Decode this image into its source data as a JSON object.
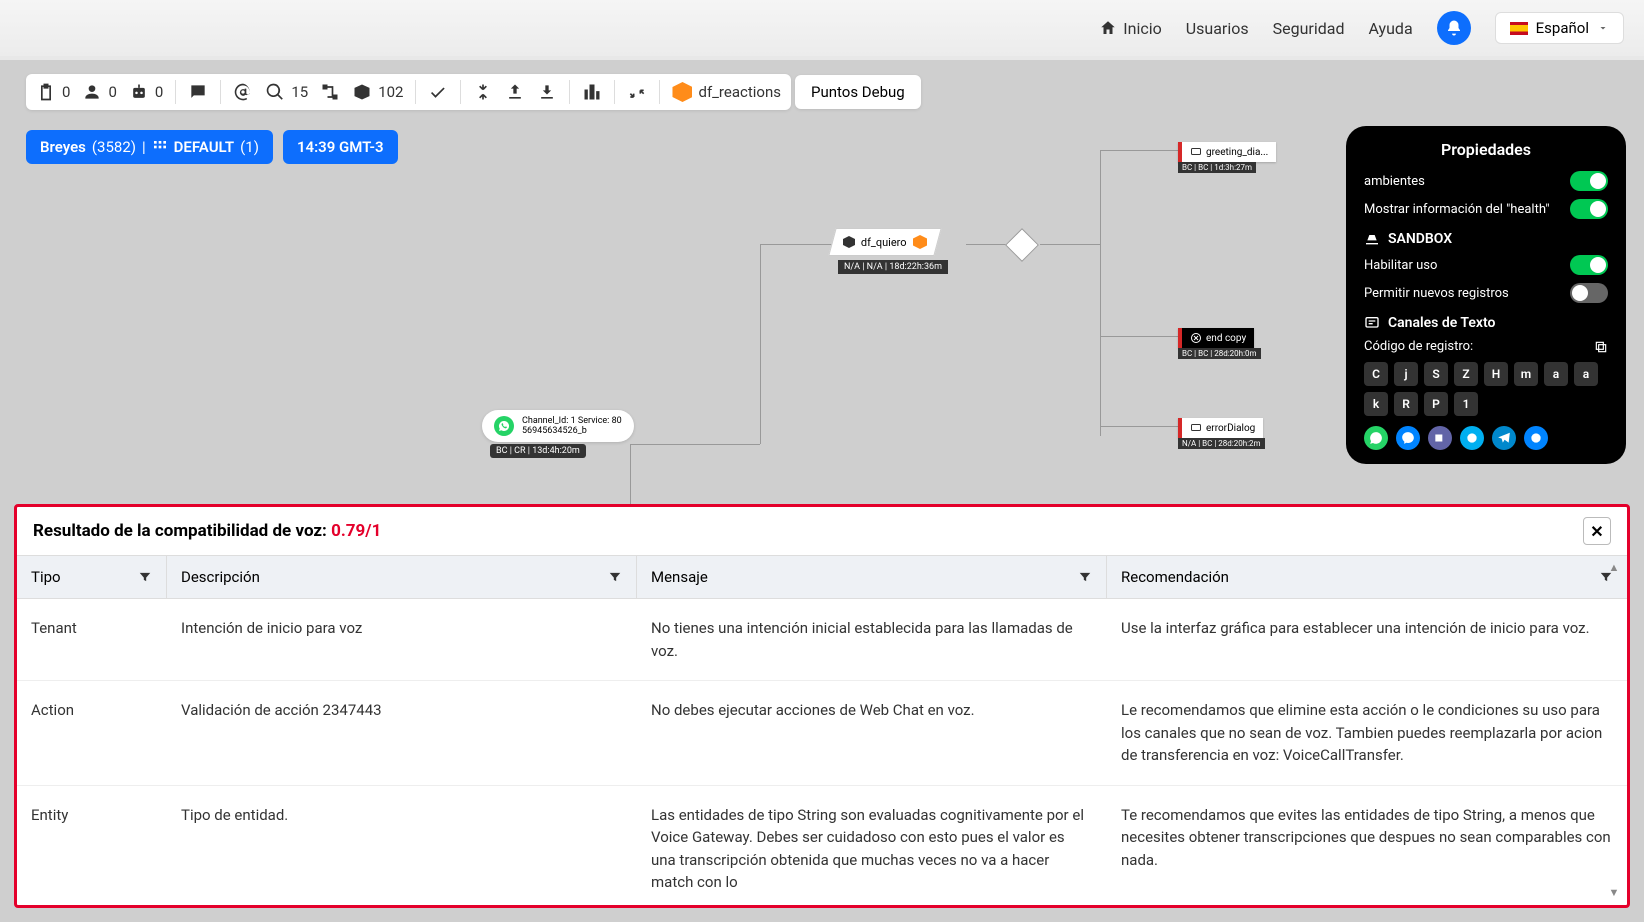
{
  "nav": {
    "home": "Inicio",
    "users": "Usuarios",
    "security": "Seguridad",
    "help": "Ayuda",
    "language": "Español"
  },
  "toolbar": {
    "counts": {
      "clipboard": "0",
      "user": "0",
      "bot": "0",
      "search": "15",
      "box": "102"
    },
    "reaction_label": "df_reactions",
    "debug": "Puntos Debug"
  },
  "badges": {
    "user": "Breyes",
    "user_count": "(3582)",
    "default": "DEFAULT",
    "default_count": "(1)",
    "time": "14:39 GMT-3"
  },
  "canvas": {
    "main_node": "df_quiero",
    "main_meta": "N/A | N/A | 18d:22h:36m",
    "wa_line1": "Channel_Id: 1 Service: 80",
    "wa_line2": "56945634526_b",
    "wa_meta": "BC | CR | 13d:4h:20m",
    "nodes": [
      {
        "label": "greeting_dia...",
        "meta": " BC | BC | 1d:3h:27m"
      },
      {
        "label": "end copy",
        "meta": " BC | BC | 28d:20h:0m"
      },
      {
        "label": "errorDialog",
        "meta": "N/A | BC | 28d:20h:2m"
      }
    ]
  },
  "props": {
    "title": "Propiedades",
    "ambientes": "ambientes",
    "health": "Mostrar información del \"health\"",
    "sandbox": "SANDBOX",
    "enable": "Habilitar uso",
    "allow_new": "Permitir nuevos registros",
    "channels": "Canales de Texto",
    "code_label": "Código de registro:",
    "code_chips": [
      "C",
      "j",
      "S",
      "Z",
      "H",
      "m",
      "a",
      "a",
      "k",
      "R",
      "P",
      "1"
    ]
  },
  "result": {
    "title_prefix": "Resultado de la compatibilidad de voz: ",
    "score": "0.79/1",
    "columns": [
      "Tipo",
      "Descripción",
      "Mensaje",
      "Recomendación"
    ],
    "rows": [
      {
        "tipo": "Tenant",
        "desc": "Intención de inicio para voz",
        "msg": "No tienes una intención inicial establecida para las llamadas de voz.",
        "rec": "Use la interfaz gráfica para establecer una intención de inicio para voz."
      },
      {
        "tipo": "Action",
        "desc": "Validación de acción 2347443",
        "msg": "No debes ejecutar acciones de Web Chat en voz.",
        "rec": "Le recomendamos que elimine esta acción o le condiciones su uso para los canales que no sean de voz. Tambien puedes reemplazarla por acion de transferencia en voz: VoiceCallTransfer."
      },
      {
        "tipo": "Entity",
        "desc": "Tipo de entidad.",
        "msg": "Las entidades de tipo String son evaluadas cognitivamente por el Voice Gateway. Debes ser cuidadoso con esto pues el valor es una transcripción obtenida que muchas veces no va a hacer match con lo",
        "rec": "Te recomendamos que evites las entidades de tipo String, a menos que necesites obtener transcripciones que despues no sean comparables con nada."
      }
    ]
  }
}
